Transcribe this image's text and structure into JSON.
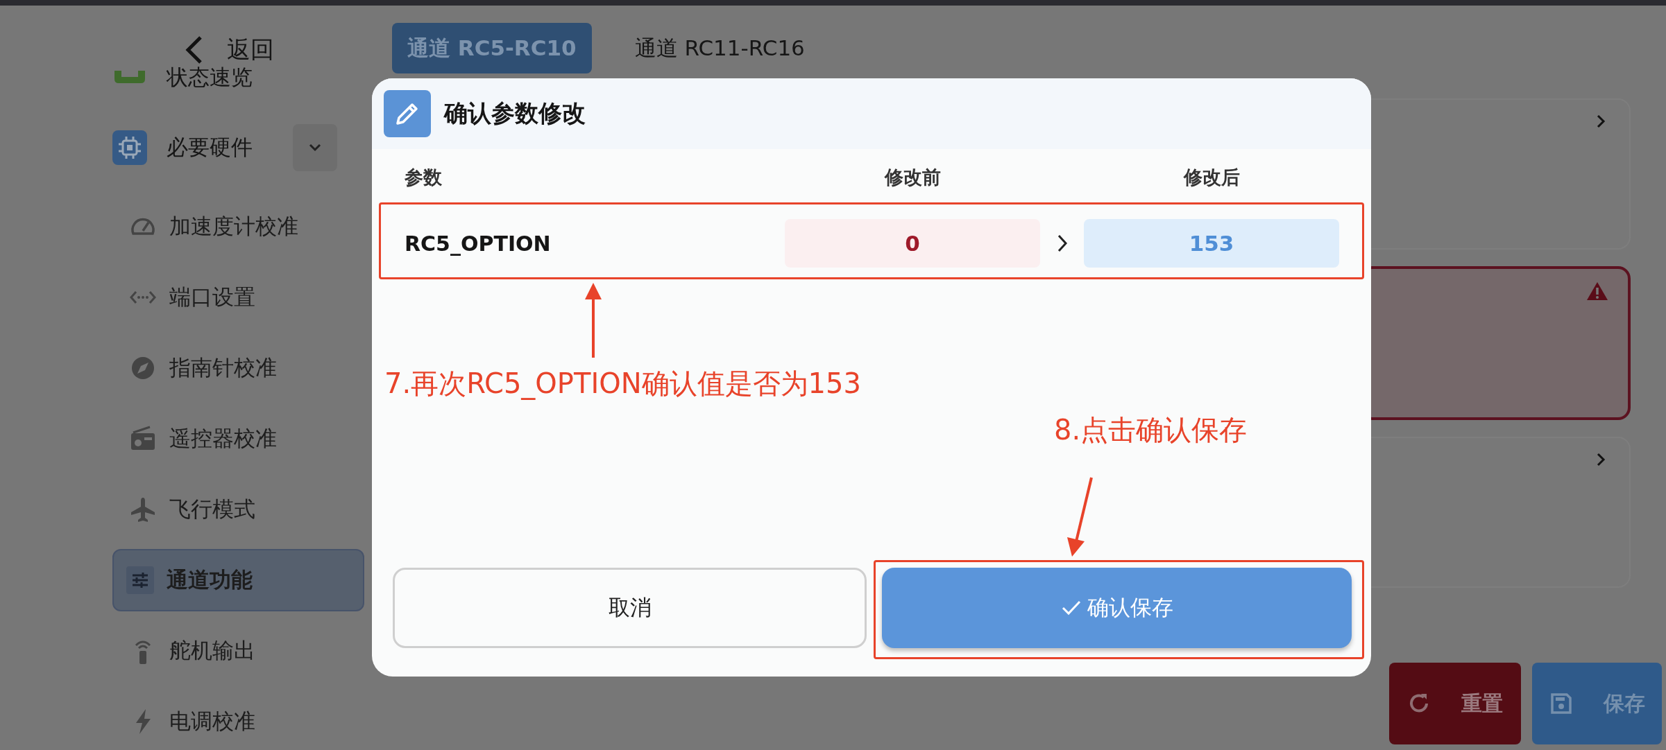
{
  "back": {
    "label": "返回"
  },
  "sidebar": {
    "overview": {
      "label": "状态速览"
    },
    "group": {
      "label": "必要硬件",
      "expanded": true
    },
    "items": [
      {
        "label": "加速度计校准",
        "selected": false
      },
      {
        "label": "端口设置",
        "selected": false
      },
      {
        "label": "指南针校准",
        "selected": false
      },
      {
        "label": "遥控器校准",
        "selected": false
      },
      {
        "label": "飞行模式",
        "selected": false
      },
      {
        "label": "通道功能",
        "selected": true
      },
      {
        "label": "舵机输出",
        "selected": false
      },
      {
        "label": "电调校准",
        "selected": false
      }
    ]
  },
  "tabs": [
    {
      "label": "通道 RC5-RC10",
      "selected": true
    },
    {
      "label": "通道 RC11-RC16",
      "selected": false
    }
  ],
  "cards": [
    {
      "kind": "nav"
    },
    {
      "kind": "warning"
    },
    {
      "kind": "nav"
    }
  ],
  "actions": [
    {
      "label": "重置",
      "kind": "reset"
    },
    {
      "label": "保存",
      "kind": "save"
    }
  ],
  "dialog": {
    "title": "确认参数修改",
    "columns": [
      "参数",
      "修改前",
      "修改后"
    ],
    "rows": [
      {
        "param": "RC5_OPTION",
        "before": "0",
        "after": "153"
      }
    ],
    "buttons": [
      {
        "label": "取消",
        "kind": "secondary"
      },
      {
        "label": "确认保存",
        "kind": "primary"
      }
    ]
  },
  "annotations": [
    {
      "text": "7.再次RC5_OPTION确认值是否为153"
    },
    {
      "text": "8.点击确认保存"
    }
  ]
}
